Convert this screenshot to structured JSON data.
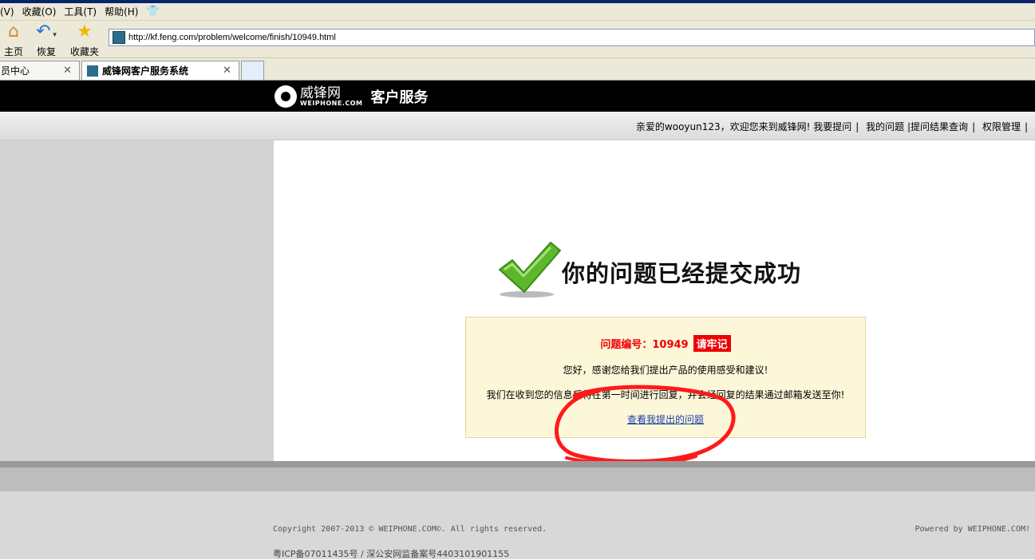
{
  "browser": {
    "menu": [
      "(V)",
      "收藏(O)",
      "工具(T)",
      "帮助(H)"
    ],
    "toolbar": {
      "home_label": "主页",
      "restore_label": "恢复",
      "favorites_label": "收藏夹"
    },
    "address_url": "http://kf.feng.com/problem/welcome/finish/10949.html",
    "tabs": [
      {
        "label": "员中心",
        "active": false
      },
      {
        "label": "威锋网客户服务系统",
        "active": true
      }
    ]
  },
  "site": {
    "logo_cn": "威锋网",
    "logo_en": "WEIPHONE.COM",
    "service_title": "客户服务",
    "nav": {
      "greeting": "亲爱的wooyun123，欢迎您来到威锋网!",
      "links": [
        "我要提问",
        "我的问题",
        "|提问结果查询",
        "权限管理"
      ]
    }
  },
  "main": {
    "headline": "你的问题已经提交成功",
    "notice": {
      "number_label": "问题编号：10949",
      "remember_badge": "请牢记",
      "thanks": "您好，感谢您给我们提出产品的使用感受和建议!",
      "info": "我们在收到您的信息后将在第一时间进行回复，并会经回复的结果通过邮箱发送至你!",
      "view_link": "查看我提出的问题"
    }
  },
  "footer": {
    "copyright": "Copyright 2007-2013 © WEIPHONE.COM©. All rights reserved.",
    "powered": "Powered by WEIPHONE.COM!",
    "icp": "粤ICP备07011435号 / 深公安网监备案号4403101901155"
  },
  "colors": {
    "accent_red": "#ee0000",
    "link_blue": "#1a3fa8",
    "notice_bg": "#fdf7d9",
    "check_green": "#5cb82a",
    "header_black": "#000000"
  }
}
